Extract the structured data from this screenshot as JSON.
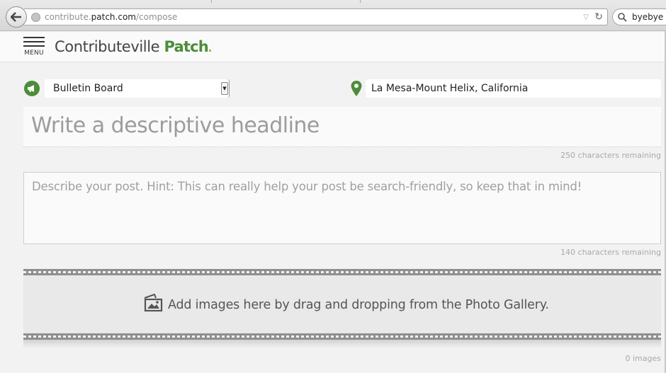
{
  "browser": {
    "url_prefix": "contribute.",
    "url_domain": "patch.com",
    "url_path": "/compose",
    "search_value": "byebye"
  },
  "site": {
    "menu_label": "MENU",
    "brand_name": "Contributeville",
    "brand_patch": "Patch",
    "brand_color": "#4c8d3a"
  },
  "compose": {
    "category": "Bulletin Board",
    "location": "La Mesa-Mount Helix, California",
    "headline_placeholder": "Write a descriptive headline",
    "headline_remaining": "250 characters remaining",
    "body_placeholder": "Describe your post. Hint: This can really help your post be search-friendly, so keep that in mind!",
    "body_remaining": "140 characters remaining",
    "images_hint": "Add images here by drag and dropping from the Photo Gallery.",
    "images_count": "0 images"
  },
  "icons": [
    "back-arrow-icon",
    "globe-icon",
    "dropdown-icon",
    "reload-icon",
    "search-icon",
    "hamburger-menu-icon",
    "megaphone-icon",
    "map-pin-icon",
    "photo-icon"
  ]
}
